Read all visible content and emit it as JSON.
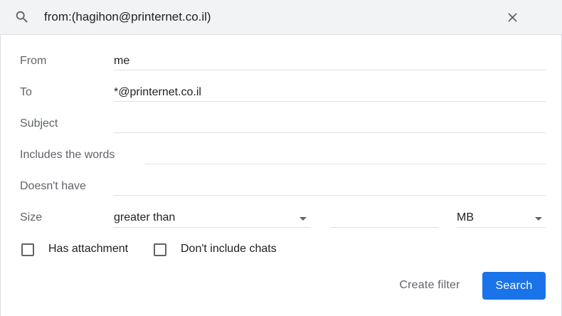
{
  "search": {
    "query": "from:(hagihon@printernet.co.il)",
    "search_icon": "search-icon",
    "close_icon": "close-icon"
  },
  "form": {
    "from": {
      "label": "From",
      "value": "me"
    },
    "to": {
      "label": "To",
      "value": "*@printernet.co.il"
    },
    "subject": {
      "label": "Subject",
      "value": ""
    },
    "includes": {
      "label": "Includes the words",
      "value": ""
    },
    "doesnt_have": {
      "label": "Doesn't have",
      "value": ""
    },
    "size": {
      "label": "Size",
      "operator": "greater than",
      "amount": "",
      "unit": "MB"
    },
    "has_attachment": {
      "label": "Has attachment",
      "checked": false
    },
    "dont_include_chats": {
      "label": "Don't include chats",
      "checked": false
    }
  },
  "actions": {
    "create_filter": "Create filter",
    "search": "Search"
  },
  "colors": {
    "primary": "#1a73e8",
    "label": "#5f6368",
    "bar_bg": "#f1f3f4"
  }
}
